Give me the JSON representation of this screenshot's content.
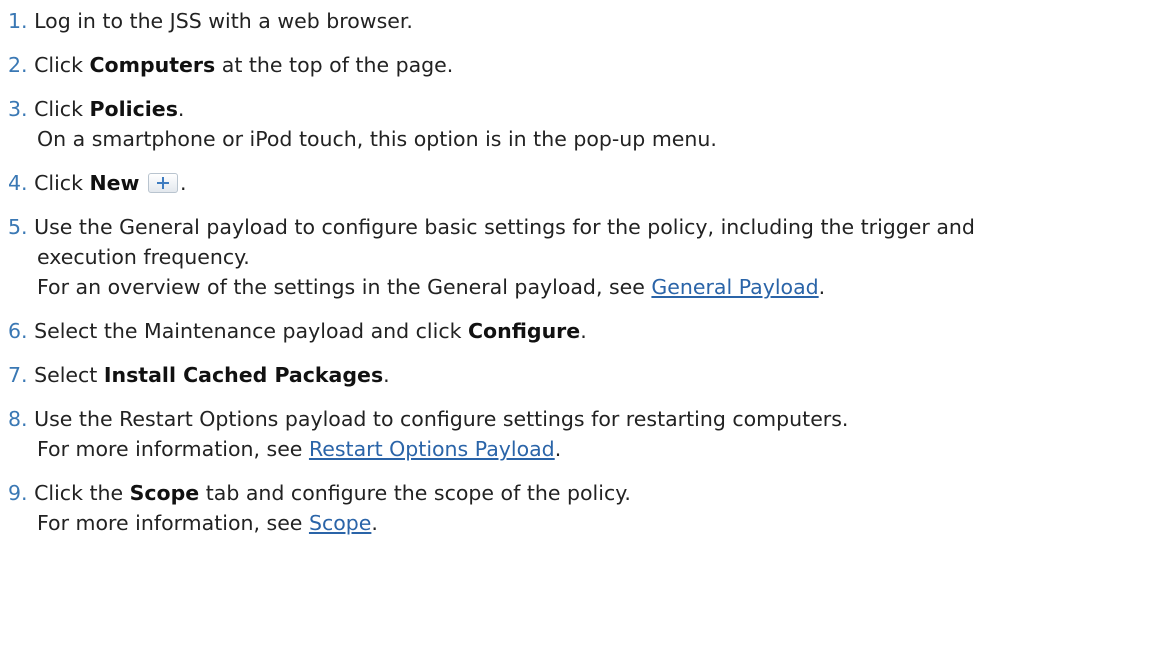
{
  "steps": [
    {
      "num": "1.",
      "parts": [
        "Log in to the JSS with a web browser."
      ]
    },
    {
      "num": "2.",
      "pre": "Click ",
      "bold": "Computers",
      "post": " at the top of the page."
    },
    {
      "num": "3.",
      "pre": "Click ",
      "bold": "Policies",
      "post": ".",
      "sub": "On a smartphone or iPod touch, this option is in the pop-up menu."
    },
    {
      "num": "4.",
      "pre": "Click ",
      "bold": "New",
      "post": ".",
      "icon": "plus-icon"
    },
    {
      "num": "5.",
      "line1": "Use the General payload to configure basic settings for the policy, including the trigger and",
      "line2": "execution frequency.",
      "sub_pre": "For an overview of the settings in the General payload, see ",
      "link": "General Payload",
      "sub_post": "."
    },
    {
      "num": "6.",
      "pre": "Select the Maintenance payload and click ",
      "bold": "Configure",
      "post": "."
    },
    {
      "num": "7.",
      "pre": "Select ",
      "bold": "Install Cached Packages",
      "post": "."
    },
    {
      "num": "8.",
      "text": "Use the Restart Options payload to configure settings for restarting computers.",
      "sub_pre": "For more information, see ",
      "link": "Restart Options Payload",
      "sub_post": "."
    },
    {
      "num": "9.",
      "pre": "Click the ",
      "bold": "Scope",
      "post": " tab and configure the scope of the policy.",
      "sub_pre": "For more information, see ",
      "link": "Scope",
      "sub_post": "."
    }
  ]
}
